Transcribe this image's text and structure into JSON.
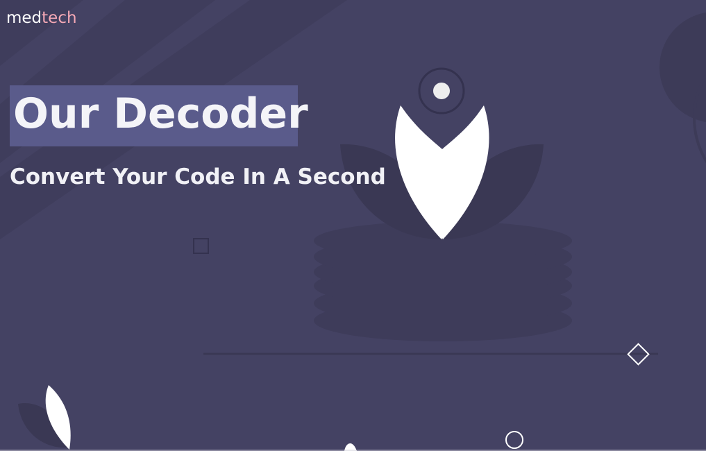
{
  "brand": {
    "name_part1": "med",
    "name_part2": "tech",
    "accent_color": "#f4a8b5"
  },
  "hero": {
    "title": "Our Decoder",
    "subtitle": "Convert Your Code In A Second",
    "title_bg_color": "#5a5b8b"
  },
  "colors": {
    "background": "#444263",
    "shape_dark": "#3a3856",
    "petal_white": "#ffffff"
  },
  "icons": [
    "lotus-illustration",
    "square-outline-icon",
    "diamond-outline-icon",
    "circle-outline-icon",
    "small-lotus-illustration"
  ]
}
